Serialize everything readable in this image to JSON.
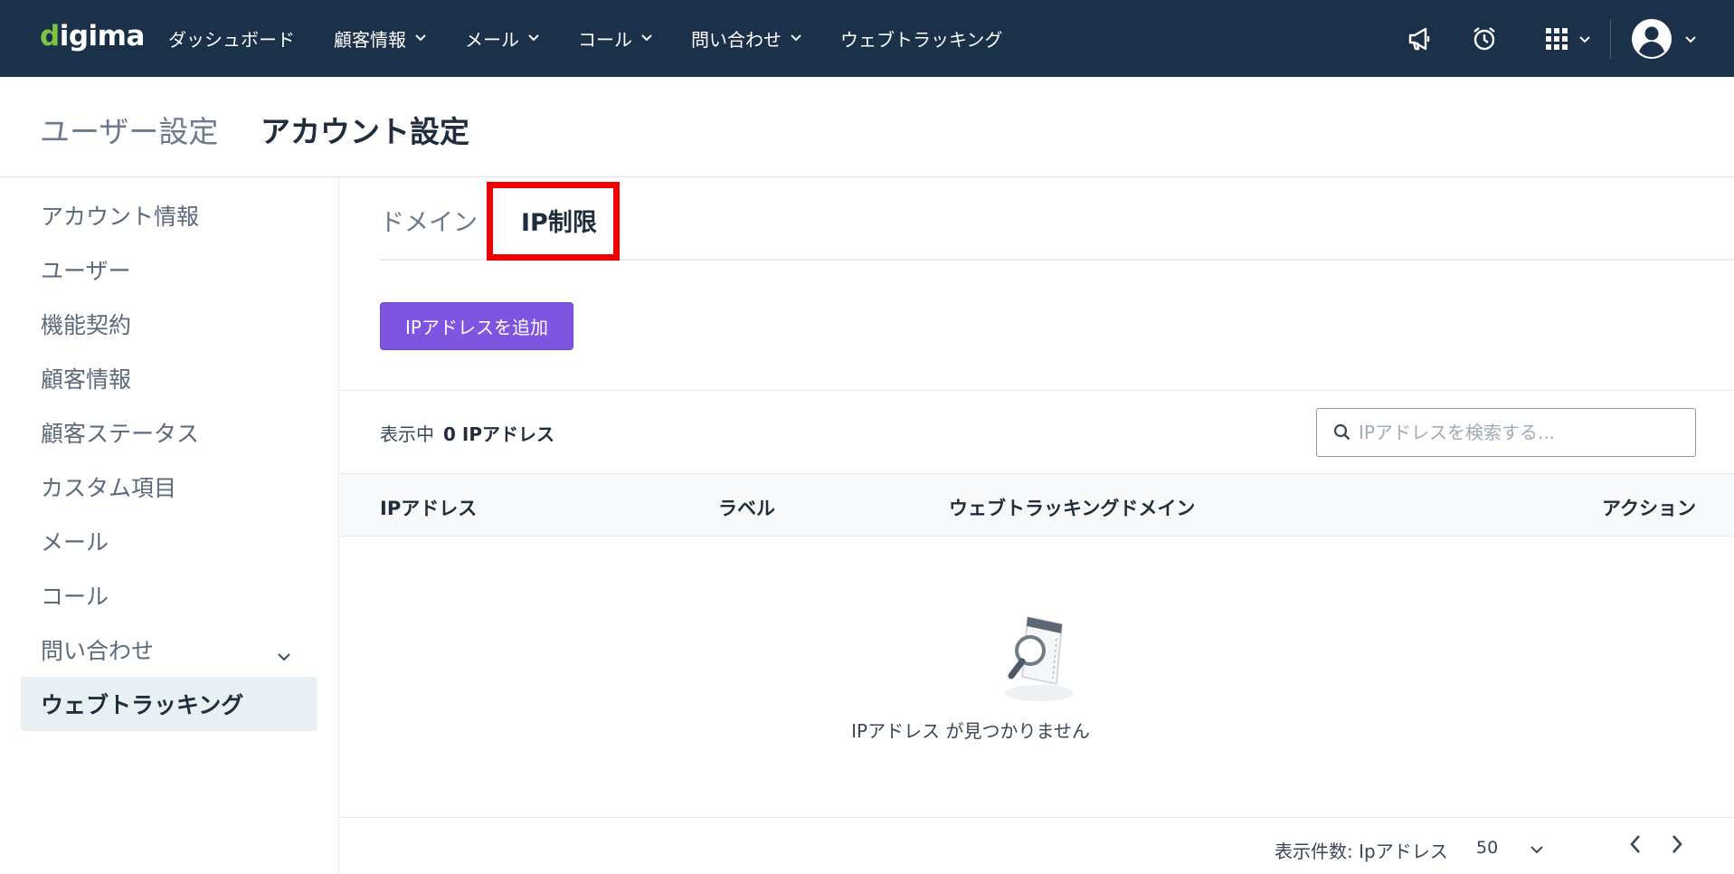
{
  "app": {
    "logo": "digima"
  },
  "nav": {
    "items": [
      {
        "label": "ダッシュボード",
        "has_dropdown": false
      },
      {
        "label": "顧客情報",
        "has_dropdown": true
      },
      {
        "label": "メール",
        "has_dropdown": true
      },
      {
        "label": "コール",
        "has_dropdown": true
      },
      {
        "label": "問い合わせ",
        "has_dropdown": true
      },
      {
        "label": "ウェブトラッキング",
        "has_dropdown": false
      }
    ],
    "right_icons": [
      "megaphone-icon",
      "alarm-clock-icon",
      "apps-grid-icon",
      "user-avatar-icon"
    ]
  },
  "header": {
    "breadcrumb_parent": "ユーザー設定",
    "title": "アカウント設定"
  },
  "sidebar": {
    "items": [
      {
        "label": "アカウント情報"
      },
      {
        "label": "ユーザー"
      },
      {
        "label": "機能契約"
      },
      {
        "label": "顧客情報"
      },
      {
        "label": "顧客ステータス"
      },
      {
        "label": "カスタム項目"
      },
      {
        "label": "メール"
      },
      {
        "label": "コール"
      },
      {
        "label": "問い合わせ"
      },
      {
        "label": "ウェブトラッキング"
      }
    ],
    "active_label": "ウェブトラッキング"
  },
  "tabs": {
    "domain": "ドメイン",
    "ip": "IP制限",
    "active": "IP制限"
  },
  "main": {
    "add_button": "IPアドレスを追加",
    "count_prefix": "表示中",
    "count_value": "0 IPアドレス",
    "search_placeholder": "IPアドレスを検索する...",
    "columns": [
      "IPアドレス",
      "ラベル",
      "ウェブトラッキングドメイン",
      "アクション"
    ],
    "empty_message": "IPアドレス が見つかりません"
  },
  "footer": {
    "per_page_label": "表示件数: Ipアドレス",
    "per_page_value": "50"
  },
  "colors": {
    "nav_bg": "#1b3049",
    "accent_green": "#7cc243",
    "button_purple": "#7e55e0",
    "highlight_red": "#ee0000"
  }
}
